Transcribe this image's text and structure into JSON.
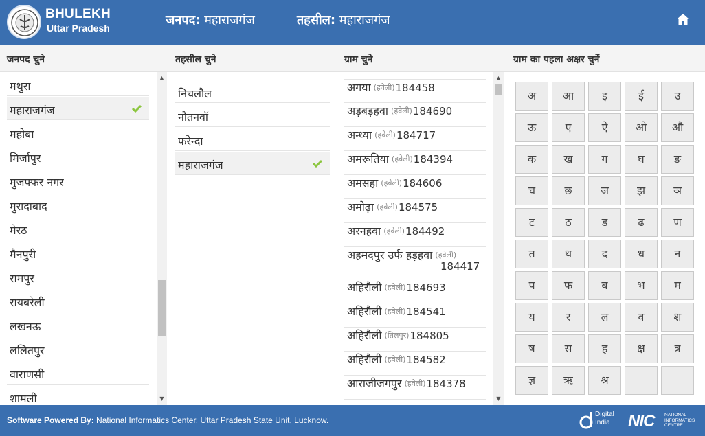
{
  "header": {
    "brand_title": "BHULEKH",
    "brand_subtitle": "Uttar Pradesh",
    "janpad_label": "जनपद:",
    "janpad_value": "महाराजगंज",
    "tehsil_label": "तहसील:",
    "tehsil_value": "महाराजगंज",
    "home_icon": "home-icon"
  },
  "columns": {
    "janpad_head": "जनपद चुने",
    "tehsil_head": "तहसील चुने",
    "gram_head": "ग्राम चुने",
    "letter_head": "ग्राम का पहला अक्षर चुनें"
  },
  "janpad_list": [
    {
      "label": "मथुरा"
    },
    {
      "label": "महाराजगंज",
      "selected": true
    },
    {
      "label": "महोबा"
    },
    {
      "label": "मिर्जापुर"
    },
    {
      "label": "मुजफ्फर नगर"
    },
    {
      "label": "मुरादाबाद"
    },
    {
      "label": "मेरठ"
    },
    {
      "label": "मैनपुरी"
    },
    {
      "label": "रामपुर"
    },
    {
      "label": "रायबरेली"
    },
    {
      "label": "लखनऊ"
    },
    {
      "label": "ललितपुर"
    },
    {
      "label": "वाराणसी"
    },
    {
      "label": "शामली"
    }
  ],
  "tehsil_list": [
    {
      "label": "निचलौल"
    },
    {
      "label": "नौतनवॉ"
    },
    {
      "label": "फरेन्दा"
    },
    {
      "label": "महाराजगंज",
      "selected": true
    }
  ],
  "gram_list": [
    {
      "name": "अगया",
      "tag": "(हवेली)",
      "code": "184458"
    },
    {
      "name": "अड़बड़हवा",
      "tag": "(हवेली)",
      "code": "184690"
    },
    {
      "name": "अन्ध्या",
      "tag": "(हवेली)",
      "code": "184717"
    },
    {
      "name": "अमरूतिया",
      "tag": "(हवेली)",
      "code": "184394"
    },
    {
      "name": "अमसहा",
      "tag": "(हवेली)",
      "code": "184606"
    },
    {
      "name": "अमोढ़ा",
      "tag": "(हवेली)",
      "code": "184575"
    },
    {
      "name": "अरनहवा",
      "tag": "(हवेली)",
      "code": "184492"
    },
    {
      "name": "अहमदपुर उर्फ हड़हवा",
      "tag": "(हवेली)",
      "code": "184417"
    },
    {
      "name": "अहिरौली",
      "tag": "(हवेली)",
      "code": "184693"
    },
    {
      "name": "अहिरौली",
      "tag": "(हवेली)",
      "code": "184541"
    },
    {
      "name": "अहिरौली",
      "tag": "(तिलपुर)",
      "code": "184805"
    },
    {
      "name": "अहिरौली",
      "tag": "(हवेली)",
      "code": "184582"
    },
    {
      "name": "आराजीजगपुर",
      "tag": "(हवेली)",
      "code": "184378"
    }
  ],
  "letters": [
    "अ",
    "आ",
    "इ",
    "ई",
    "उ",
    "ऊ",
    "ए",
    "ऐ",
    "ओ",
    "औ",
    "क",
    "ख",
    "ग",
    "घ",
    "ङ",
    "च",
    "छ",
    "ज",
    "झ",
    "ञ",
    "ट",
    "ठ",
    "ड",
    "ढ",
    "ण",
    "त",
    "थ",
    "द",
    "ध",
    "न",
    "प",
    "फ",
    "ब",
    "भ",
    "म",
    "य",
    "र",
    "ल",
    "व",
    "श",
    "ष",
    "स",
    "ह",
    "क्ष",
    "त्र",
    "ज्ञ",
    "ऋ",
    "श्र",
    "",
    ""
  ],
  "footer": {
    "powered_label": "Software Powered By:",
    "powered_value": "National Informatics Center, Uttar Pradesh State Unit, Lucknow.",
    "digital_india_1": "Digital",
    "digital_india_2": "India",
    "nic_logo": "NIC",
    "nic_line1": "NATIONAL",
    "nic_line2": "INFORMATICS",
    "nic_line3": "CENTRE"
  },
  "colors": {
    "header_bg": "#3a6fb0",
    "check": "#8cc63f"
  }
}
